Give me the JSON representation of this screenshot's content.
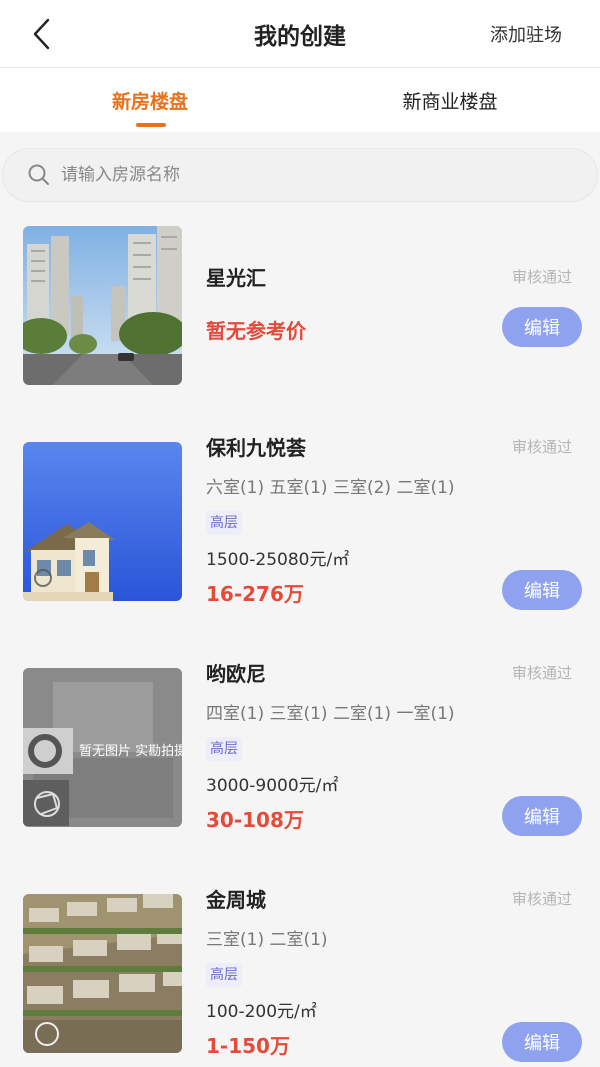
{
  "header": {
    "title": "我的创建",
    "add_label": "添加驻场"
  },
  "tabs": [
    {
      "label": "新房楼盘",
      "active": true
    },
    {
      "label": "新商业楼盘",
      "active": false
    }
  ],
  "search": {
    "placeholder": "请输入房源名称"
  },
  "listings": [
    {
      "name": "星光汇",
      "status": "审核通过",
      "price": "暂无参考价",
      "edit_label": "编辑"
    },
    {
      "name": "保利九悦荟",
      "status": "审核通过",
      "rooms": "六室(1) 五室(1) 三室(2) 二室(1)",
      "tag": "高层",
      "unit_price": "1500-25080元/㎡",
      "total_price": "16-276万",
      "edit_label": "编辑"
    },
    {
      "name": "哟欧尼",
      "status": "审核通过",
      "rooms": "四室(1) 三室(1) 二室(1) 一室(1)",
      "tag": "高层",
      "unit_price": "3000-9000元/㎡",
      "total_price": "30-108万",
      "edit_label": "编辑",
      "thumb_text": "暂无图片 实勘拍摄中..."
    },
    {
      "name": "金周城",
      "status": "审核通过",
      "rooms": "三室(1) 二室(1)",
      "tag": "高层",
      "unit_price": "100-200元/㎡",
      "total_price": "1-150万",
      "edit_label": "编辑"
    }
  ],
  "colors": {
    "accent": "#e8731f",
    "price": "#e34b3a",
    "edit_button": "#8fa2ef",
    "tag_text": "#6c6cc9"
  }
}
